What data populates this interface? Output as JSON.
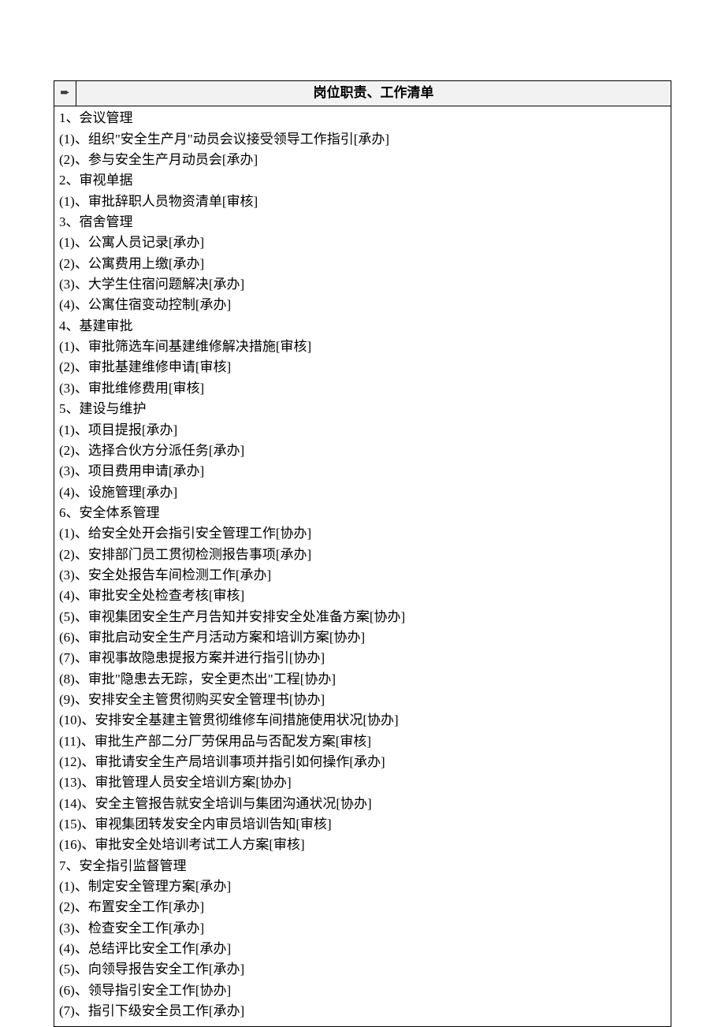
{
  "header": {
    "arrow": "➨",
    "title": "岗位职责、工作清单"
  },
  "lines": [
    "1、会议管理",
    "(1)、组织\"安全生产月\"动员会议接受领导工作指引[承办]",
    "(2)、参与安全生产月动员会[承办]",
    "2、审视单据",
    "(1)、审批辞职人员物资清单[审核]",
    "3、宿舍管理",
    "(1)、公寓人员记录[承办]",
    "(2)、公寓费用上缴[承办]",
    "(3)、大学生住宿问题解决[承办]",
    "(4)、公寓住宿变动控制[承办]",
    "4、基建审批",
    "(1)、审批筛选车间基建维修解决措施[审核]",
    "(2)、审批基建维修申请[审核]",
    "(3)、审批维修费用[审核]",
    "5、建设与维护",
    "(1)、项目提报[承办]",
    "(2)、选择合伙方分派任务[承办]",
    "(3)、项目费用申请[承办]",
    "(4)、设施管理[承办]",
    "6、安全体系管理",
    "(1)、给安全处开会指引安全管理工作[协办]",
    "(2)、安排部门员工贯彻检测报告事项[承办]",
    "(3)、安全处报告车间检测工作[承办]",
    "(4)、审批安全处检查考核[审核]",
    "(5)、审视集团安全生产月告知并安排安全处准备方案[协办]",
    "(6)、审批启动安全生产月活动方案和培训方案[协办]",
    "(7)、审视事故隐患提报方案并进行指引[协办]",
    "(8)、审批\"隐患去无踪，安全更杰出\"工程[协办]",
    "(9)、安排安全主管贯彻购买安全管理书[协办]",
    "(10)、安排安全基建主管贯彻维修车间措施使用状况[协办]",
    "(11)、审批生产部二分厂劳保用品与否配发方案[审核]",
    "(12)、审批请安全生产局培训事项并指引如何操作[承办]",
    "(13)、审批管理人员安全培训方案[协办]",
    "(14)、安全主管报告就安全培训与集团沟通状况[协办]",
    "(15)、审视集团转发安全内审员培训告知[审核]",
    "(16)、审批安全处培训考试工人方案[审核]",
    "7、安全指引监督管理",
    "(1)、制定安全管理方案[承办]",
    "(2)、布置安全工作[承办]",
    "(3)、检查安全工作[承办]",
    "(4)、总结评比安全工作[承办]",
    "(5)、向领导报告安全工作[承办]",
    "(6)、领导指引安全工作[协办]",
    "(7)、指引下级安全员工作[承办]"
  ]
}
